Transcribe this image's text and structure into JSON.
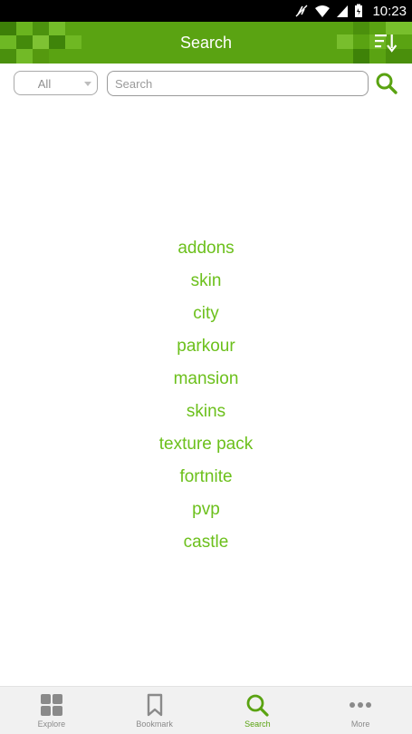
{
  "status_bar": {
    "time": "10:23"
  },
  "app_bar": {
    "title": "Search",
    "sort_icon": "sort-descending-icon"
  },
  "search": {
    "filter_value": "All",
    "placeholder": "Search",
    "value": ""
  },
  "suggestions": [
    "addons",
    "skin",
    "city",
    "parkour",
    "mansion",
    "skins",
    "texture pack",
    "fortnite",
    "pvp",
    "castle"
  ],
  "bottom_nav": {
    "items": [
      {
        "label": "Explore",
        "icon": "grid-icon"
      },
      {
        "label": "Bookmark",
        "icon": "bookmark-icon"
      },
      {
        "label": "Search",
        "icon": "search-icon",
        "active": true
      },
      {
        "label": "More",
        "icon": "more-dots-icon"
      }
    ]
  },
  "colors": {
    "app_bar": "#5aa312",
    "accent": "#6cc01c",
    "nav_background": "#f1f1f1",
    "inactive": "#8a8a8a"
  }
}
